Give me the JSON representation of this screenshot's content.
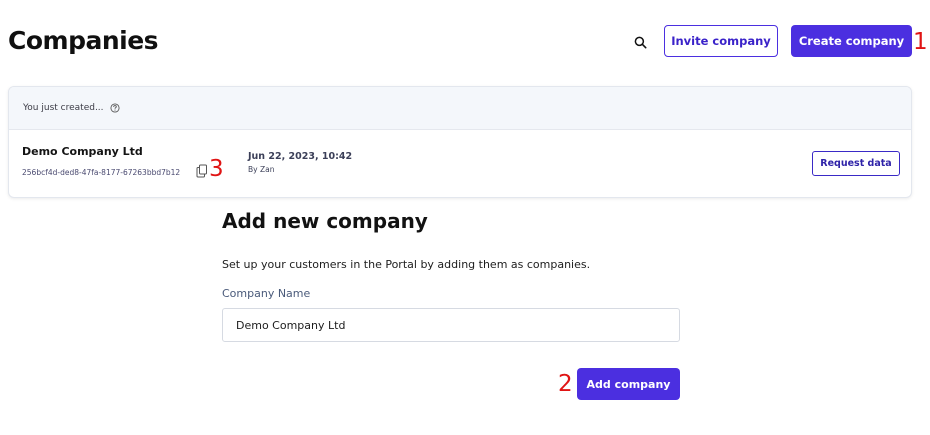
{
  "header": {
    "title": "Companies",
    "search_icon": "search-icon",
    "invite_label": "Invite company",
    "create_label": "Create company"
  },
  "recent": {
    "label": "You just created...",
    "help_icon": "help-circle-icon",
    "company_name": "Demo Company Ltd",
    "company_id": "256bcf4d-ded8-47fa-8177-67263bbd7b12",
    "copy_icon": "copy-icon",
    "created_at": "Jun 22, 2023, 10:42",
    "created_by": "By Zan",
    "request_label": "Request data"
  },
  "form": {
    "title": "Add new company",
    "description": "Set up your customers in the Portal by adding them as companies.",
    "name_label": "Company Name",
    "name_value": "Demo Company Ltd",
    "submit_label": "Add company"
  },
  "annotations": [
    "1",
    "2",
    "3"
  ],
  "colors": {
    "primary": "#4b2fe0",
    "annotation": "#e01414",
    "card_header_bg": "#f4f7fb"
  }
}
